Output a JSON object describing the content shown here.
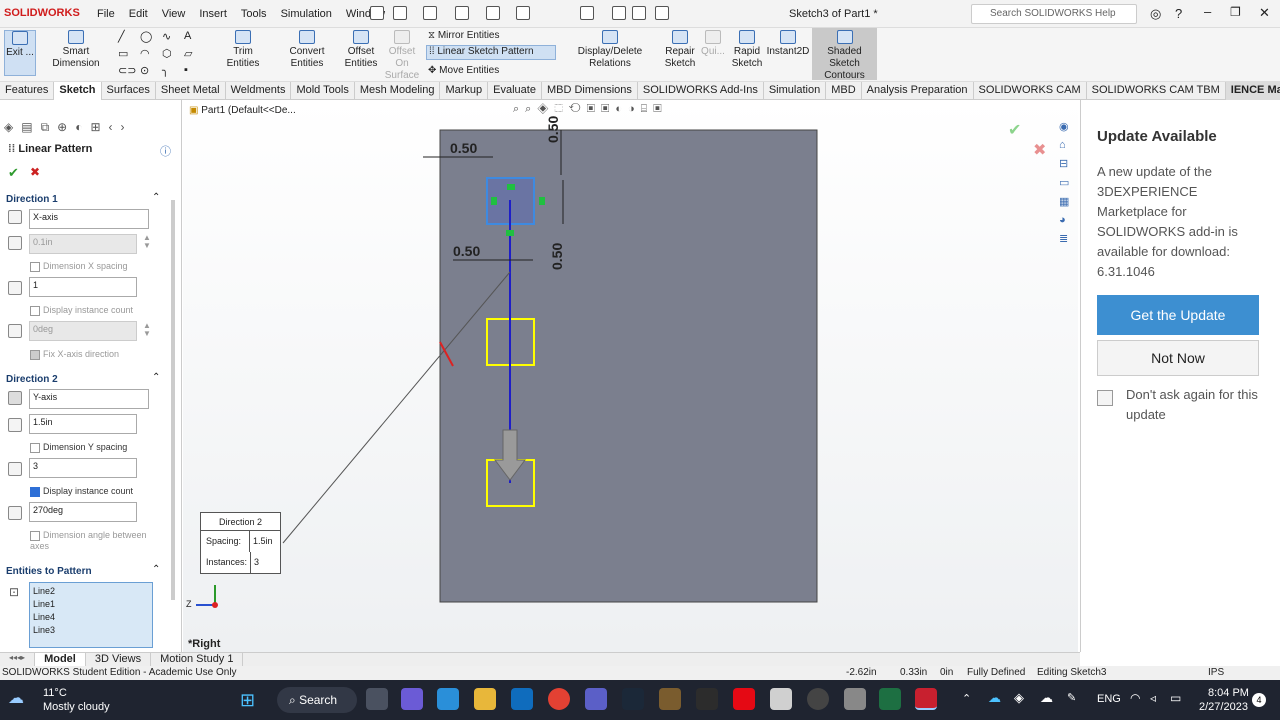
{
  "app": {
    "logo": "SOLIDWORKS",
    "doc_title": "Sketch3 of Part1 *",
    "search_placeholder": "Search SOLIDWORKS Help",
    "menu": [
      "File",
      "Edit",
      "View",
      "Insert",
      "Tools",
      "Simulation",
      "Window"
    ]
  },
  "ribbon": {
    "exit": "Exit ...",
    "smart_dimension": "Smart Dimension",
    "trim": "Trim Entities",
    "convert": "Convert Entities",
    "offset": "Offset Entities",
    "offset_surface": "Offset On Surface",
    "mirror": "Mirror Entities",
    "linear_pattern": "Linear Sketch Pattern",
    "move": "Move Entities",
    "display_delete": "Display/Delete Relations",
    "repair": "Repair Sketch",
    "quick": "Qui...",
    "rapid": "Rapid Sketch",
    "instant2d": "Instant2D",
    "shaded": "Shaded Sketch Contours"
  },
  "tabs": [
    "Features",
    "Sketch",
    "Surfaces",
    "Sheet Metal",
    "Weldments",
    "Mold Tools",
    "Mesh Modeling",
    "Markup",
    "Evaluate",
    "MBD Dimensions",
    "SOLIDWORKS Add-Ins",
    "Simulation",
    "MBD",
    "Analysis Preparation",
    "SOLIDWORKS CAM",
    "SOLIDWORKS CAM TBM",
    "IENCE Marketplace"
  ],
  "active_tab": "Sketch",
  "property": {
    "title": "Linear Pattern",
    "dir1": {
      "heading": "Direction 1",
      "axis": "X-axis",
      "spacing": "0.1in",
      "dim_spacing": "Dimension X spacing",
      "count": "1",
      "display_count": "Display instance count",
      "angle": "0deg",
      "fix": "Fix X-axis direction"
    },
    "dir2": {
      "heading": "Direction 2",
      "axis": "Y-axis",
      "spacing": "1.5in",
      "dim_spacing": "Dimension Y spacing",
      "count": "3",
      "display_count": "Display instance count",
      "angle": "270deg",
      "dim_angle": "Dimension angle between axes"
    },
    "entities": {
      "heading": "Entities to Pattern",
      "items": [
        "Line2",
        "Line1",
        "Line4",
        "Line3"
      ]
    }
  },
  "canvas": {
    "breadcrumb": "Part1  (Default<<De...",
    "view_label": "*Right",
    "dims": {
      "top_h": "0.50",
      "top_v": "0.50",
      "mid_h": "0.50",
      "mid_v": "0.50"
    },
    "callout": {
      "title": "Direction 2",
      "spacing_label": "Spacing:",
      "spacing": "1.5in",
      "instances_label": "Instances:",
      "instances": "3"
    },
    "triad_z": "Z"
  },
  "update": {
    "title": "Update Available",
    "body": "A new update of the 3DEXPERIENCE Marketplace for SOLIDWORKS add-in is available for download: 6.31.1046",
    "get": "Get the Update",
    "not_now": "Not Now",
    "dont_ask": "Don't ask again for this update"
  },
  "bottom_tabs": [
    "Model",
    "3D Views",
    "Motion Study 1"
  ],
  "status": {
    "edition": "SOLIDWORKS Student Edition - Academic Use Only",
    "x": "-2.62in",
    "y": "0.33in",
    "z": "0in",
    "defined": "Fully Defined",
    "editing": "Editing Sketch3",
    "units": "IPS"
  },
  "taskbar": {
    "temp": "11°C",
    "weather": "Mostly cloudy",
    "search": "Search",
    "lang": "ENG",
    "time": "8:04 PM",
    "date": "2/27/2023"
  },
  "colors": {
    "accent": "#3d8fd1",
    "sketch_plane": "#7b7f8e",
    "selected": "#ffff00",
    "brand": "#d01c1c"
  }
}
